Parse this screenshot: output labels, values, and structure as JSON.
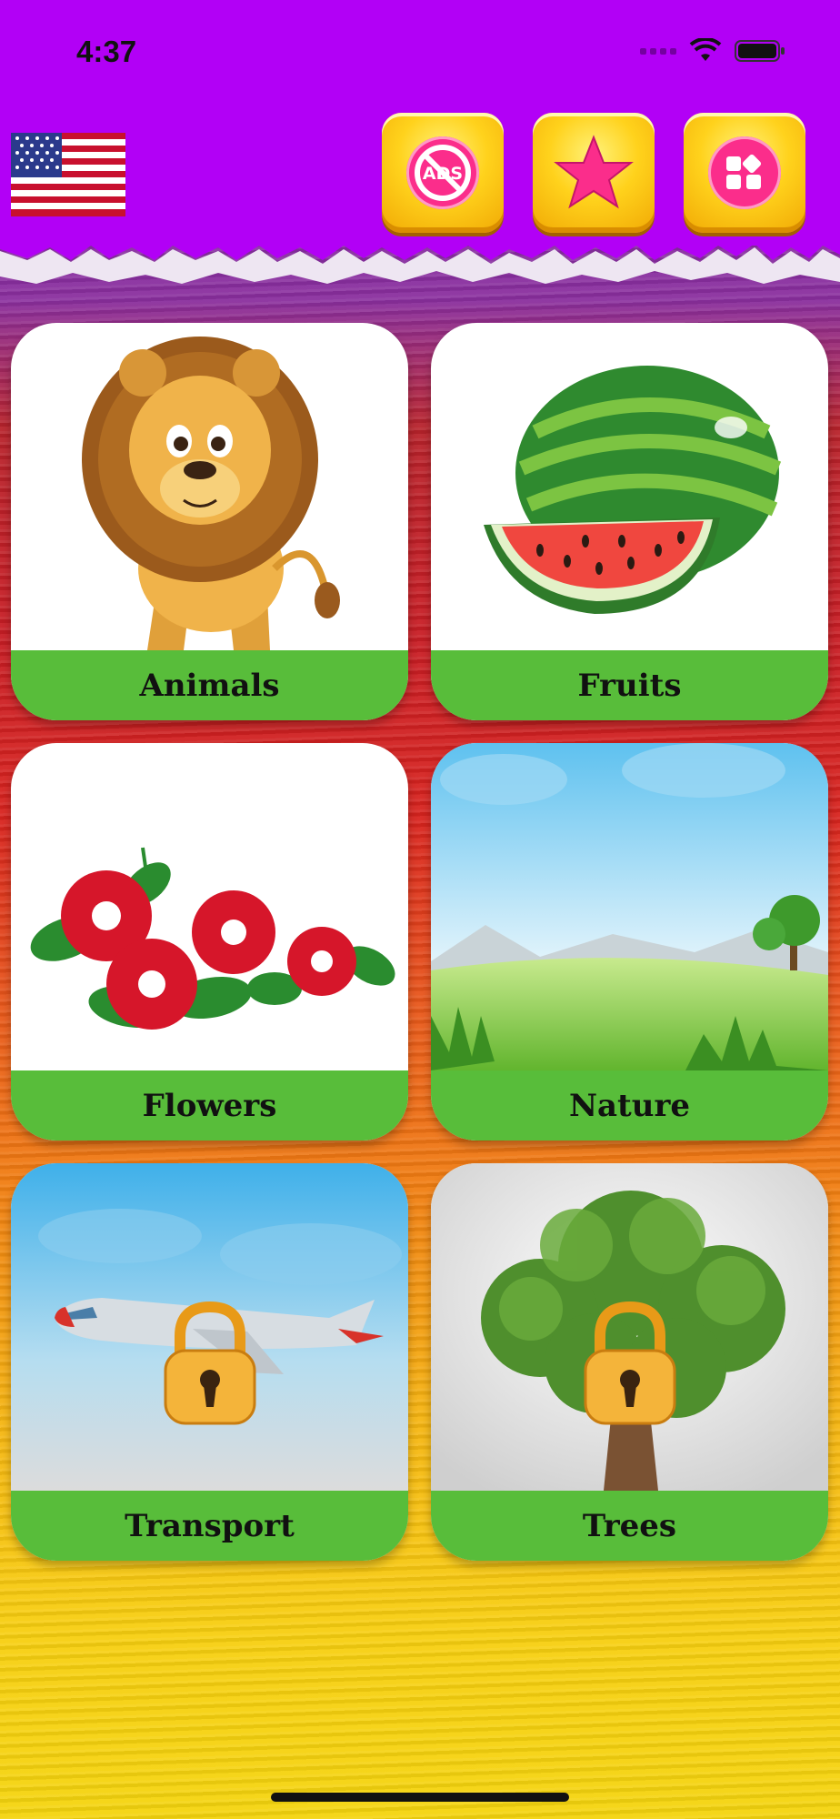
{
  "status_bar": {
    "time": "4:37"
  },
  "header": {
    "language_flag": "us-flag-icon",
    "buttons": [
      {
        "name": "remove-ads-button",
        "icon": "no-ads-icon",
        "icon_text": "ADS"
      },
      {
        "name": "favorites-button",
        "icon": "star-icon"
      },
      {
        "name": "more-apps-button",
        "icon": "apps-grid-icon"
      }
    ]
  },
  "categories": [
    {
      "label": "Animals",
      "image": "lion",
      "locked": false
    },
    {
      "label": "Fruits",
      "image": "watermelon",
      "locked": false
    },
    {
      "label": "Flowers",
      "image": "red-flowers",
      "locked": false
    },
    {
      "label": "Nature",
      "image": "meadow-landscape",
      "locked": false
    },
    {
      "label": "Transport",
      "image": "airplane",
      "locked": true
    },
    {
      "label": "Trees",
      "image": "tree",
      "locked": true
    }
  ],
  "colors": {
    "header": "#b200f6",
    "label_bar": "#58bd3a",
    "button_gold": "#ffd21c",
    "button_pink": "#fb2d8b"
  }
}
